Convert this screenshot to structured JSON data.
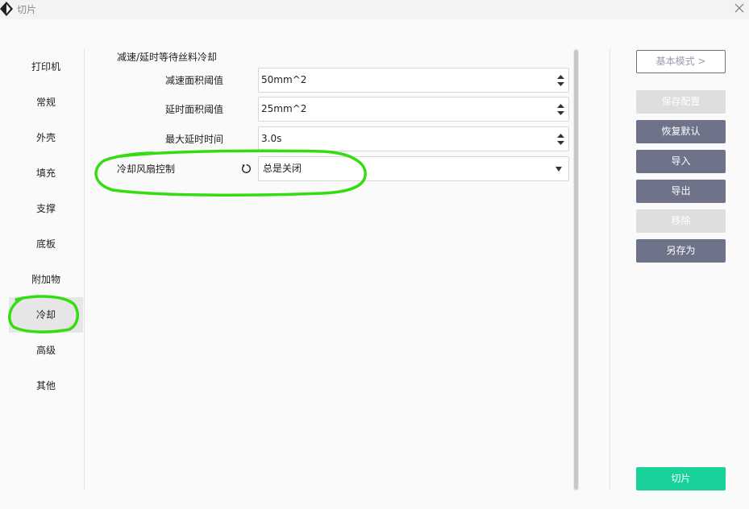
{
  "window": {
    "title": "切片",
    "app_icon": "app-logo-icon",
    "close_icon": "close-icon"
  },
  "sidebar": {
    "items": [
      {
        "label": "打印机",
        "active": false
      },
      {
        "label": "常规",
        "active": false
      },
      {
        "label": "外壳",
        "active": false
      },
      {
        "label": "填充",
        "active": false
      },
      {
        "label": "支撑",
        "active": false
      },
      {
        "label": "底板",
        "active": false
      },
      {
        "label": "附加物",
        "active": false
      },
      {
        "label": "冷却",
        "active": true
      },
      {
        "label": "高级",
        "active": false
      },
      {
        "label": "其他",
        "active": false
      }
    ]
  },
  "settings": {
    "section_title": "减速/延时等待丝料冷却",
    "rows": [
      {
        "label": "减速面积阈值",
        "value": "50mm^2",
        "control": "spinbox"
      },
      {
        "label": "延时面积阈值",
        "value": "25mm^2",
        "control": "spinbox"
      },
      {
        "label": "最大延时时间",
        "value": "3.0s",
        "control": "spinbox"
      },
      {
        "label": "冷却风扇控制",
        "value": "总是关闭",
        "control": "dropdown",
        "reset_icon": "reset-icon"
      }
    ]
  },
  "actions": {
    "basic_mode": "基本模式 >",
    "save_config": "保存配置",
    "restore_default": "恢复默认",
    "import": "导入",
    "export": "导出",
    "remove": "移除",
    "save_as": "另存为",
    "slice": "切片"
  },
  "colors": {
    "accent_dark": "#6f7389",
    "disabled": "#dedede",
    "primary_green": "#19d29b",
    "annotation_green": "#33dd11"
  },
  "annotations": [
    "hand-drawn green circle around 冷却 sidebar item",
    "hand-drawn green ellipse around 冷却风扇控制 row"
  ]
}
